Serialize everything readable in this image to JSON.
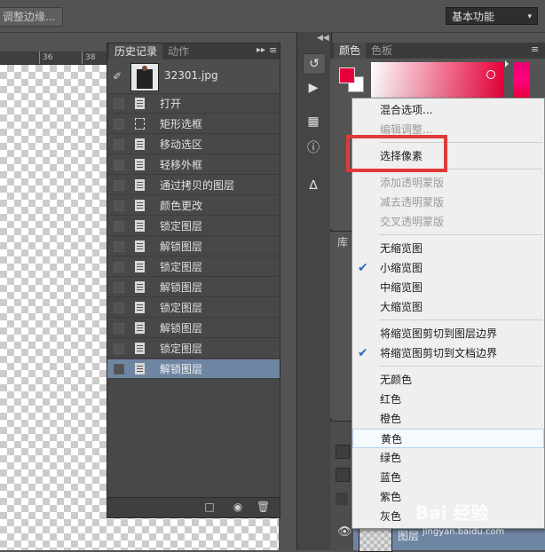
{
  "topbar": {
    "refine_edge": "调整边缘...",
    "workspace": "基本功能"
  },
  "ruler": {
    "ticks": [
      "36",
      "38"
    ]
  },
  "history": {
    "tabs": [
      "历史记录",
      "动作"
    ],
    "snapshot_name": "32301.jpg",
    "items": [
      {
        "label": "打开",
        "icon": "document-icon"
      },
      {
        "label": "矩形选框",
        "icon": "marquee-icon"
      },
      {
        "label": "移动选区",
        "icon": "document-icon"
      },
      {
        "label": "轻移外框",
        "icon": "document-icon"
      },
      {
        "label": "通过拷贝的图层",
        "icon": "document-icon"
      },
      {
        "label": "颜色更改",
        "icon": "document-icon"
      },
      {
        "label": "锁定图层",
        "icon": "document-icon"
      },
      {
        "label": "解锁图层",
        "icon": "document-icon"
      },
      {
        "label": "锁定图层",
        "icon": "document-icon"
      },
      {
        "label": "解锁图层",
        "icon": "document-icon"
      },
      {
        "label": "锁定图层",
        "icon": "document-icon"
      },
      {
        "label": "解锁图层",
        "icon": "document-icon"
      },
      {
        "label": "锁定图层",
        "icon": "document-icon"
      },
      {
        "label": "解锁图层",
        "icon": "document-icon"
      }
    ],
    "active_index": 13
  },
  "color_panel": {
    "tabs": [
      "颜色",
      "色板"
    ],
    "foreground": "#e8003a",
    "background": "#ffffff"
  },
  "lib_panel": {
    "label": "库"
  },
  "layers_panel": {
    "layer_name": "图层"
  },
  "menu": {
    "items": [
      {
        "label": "混合选项...",
        "disabled": false,
        "checked": false
      },
      {
        "label": "编辑调整...",
        "disabled": true,
        "checked": false
      },
      {
        "sep": true
      },
      {
        "label": "选择像素",
        "disabled": false,
        "checked": false
      },
      {
        "sep": true
      },
      {
        "label": "添加透明蒙版",
        "disabled": true,
        "checked": false
      },
      {
        "label": "减去透明蒙版",
        "disabled": true,
        "checked": false
      },
      {
        "label": "交叉透明蒙版",
        "disabled": true,
        "checked": false
      },
      {
        "sep": true
      },
      {
        "label": "无缩览图",
        "disabled": false,
        "checked": false
      },
      {
        "label": "小缩览图",
        "disabled": false,
        "checked": true
      },
      {
        "label": "中缩览图",
        "disabled": false,
        "checked": false
      },
      {
        "label": "大缩览图",
        "disabled": false,
        "checked": false
      },
      {
        "sep": true
      },
      {
        "label": "将缩览图剪切到图层边界",
        "disabled": false,
        "checked": false
      },
      {
        "label": "将缩览图剪切到文档边界",
        "disabled": false,
        "checked": true
      },
      {
        "sep": true
      },
      {
        "label": "无颜色",
        "disabled": false,
        "checked": false
      },
      {
        "label": "红色",
        "disabled": false,
        "checked": false
      },
      {
        "label": "橙色",
        "disabled": false,
        "checked": false
      },
      {
        "label": "黄色",
        "disabled": false,
        "checked": false,
        "highlighted": true
      },
      {
        "label": "绿色",
        "disabled": false,
        "checked": false
      },
      {
        "label": "蓝色",
        "disabled": false,
        "checked": false
      },
      {
        "label": "紫色",
        "disabled": false,
        "checked": false
      },
      {
        "label": "灰色",
        "disabled": false,
        "checked": false
      }
    ]
  },
  "watermark": {
    "brand": "Bai 经验",
    "url": "jingyan.baidu.com"
  },
  "check_mark": "✔"
}
